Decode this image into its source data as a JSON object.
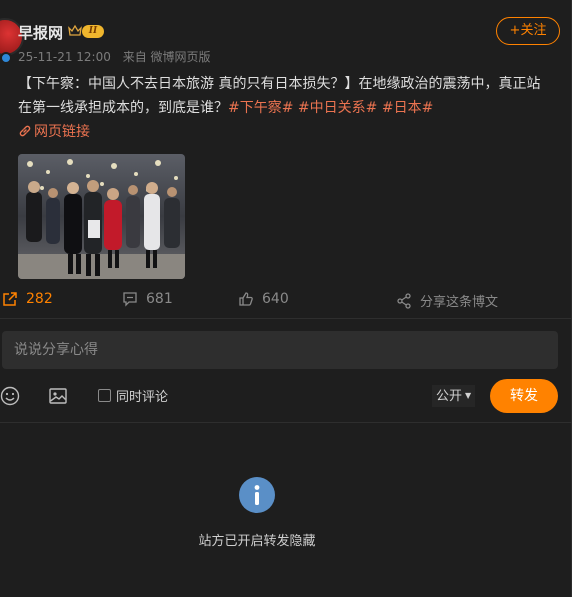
{
  "user": {
    "name": "早报网",
    "level": "II",
    "time": "25-11-21 12:00",
    "source": "来自 微博网页版",
    "follow_label": "+关注"
  },
  "post": {
    "text_main": "【下午察：中国人不去日本旅游 真的只有日本损失？】在地缘政治的震荡中，真正站在第一线承担成本的，到底是谁？",
    "tags": [
      "#下午察#",
      "#中日关系#",
      "#日本#"
    ],
    "weblink_label": "网页链接"
  },
  "actions": {
    "repost_count": "282",
    "comment_count": "681",
    "like_count": "640",
    "share_label": "分享这条博文"
  },
  "composer": {
    "placeholder": "说说分享心得",
    "also_comment_label": "同时评论",
    "visibility": "公开",
    "repost_button": "转发"
  },
  "notice": "站方已开启转发隐藏",
  "colors": {
    "accent": "#ff8200",
    "tag": "#eb7350",
    "background": "#1e1e1e",
    "info_icon": "#5a8fc7"
  },
  "icons": [
    "crown-icon",
    "link-icon",
    "repost-icon",
    "comment-icon",
    "like-icon",
    "share-icon",
    "emoji-icon",
    "image-icon",
    "info-icon",
    "verified-icon"
  ]
}
